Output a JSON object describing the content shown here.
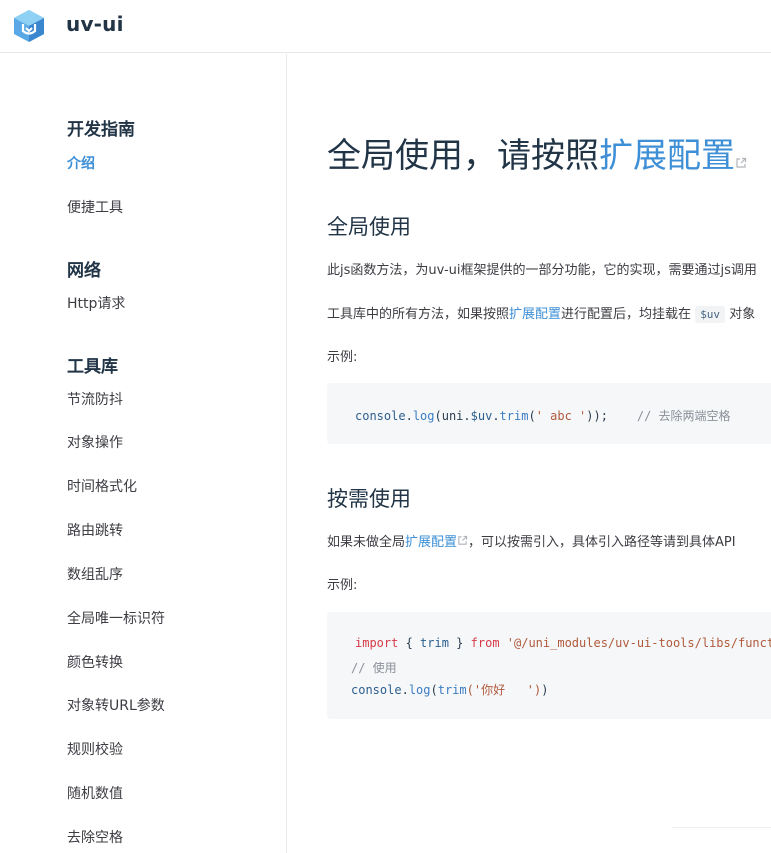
{
  "header": {
    "brand": "uv-ui",
    "logo_icon": "uv-ui-logo-icon"
  },
  "sidebar": {
    "groups": [
      {
        "title": "开发指南",
        "items": [
          "介绍",
          "便捷工具"
        ]
      },
      {
        "title": "网络",
        "items": [
          "Http请求"
        ]
      },
      {
        "title": "工具库",
        "items": [
          "节流防抖",
          "对象操作",
          "时间格式化",
          "路由跳转",
          "数组乱序",
          "全局唯一标识符",
          "颜色转换",
          "对象转URL参数",
          "规则校验",
          "随机数值",
          "去除空格"
        ]
      }
    ],
    "active_item": "介绍"
  },
  "main": {
    "title_prefix": "全局使用，请按照",
    "title_link": "扩展配置",
    "section1": {
      "heading": "全局使用",
      "para1": "此js函数方法，为uv-ui框架提供的一部分功能，它的实现，需要通过js调用",
      "para2_prefix": "工具库中的所有方法，如果按照",
      "para2_link": "扩展配置",
      "para2_middle": "进行配置后，均挂载在",
      "para2_code": "$uv",
      "para2_suffix": "对象",
      "example_label": "示例:",
      "code": {
        "obj": "console",
        "dot1": ".",
        "method1": "log",
        "open1": "(uni.",
        "var1": "$uv",
        "dot2": ".",
        "method2": "trim",
        "open2": "(",
        "arg": "' abc '",
        "close": "));",
        "comment": "// 去除两端空格"
      }
    },
    "section2": {
      "heading": "按需使用",
      "para_prefix": "如果未做全局",
      "para_link": "扩展配置",
      "para_suffix": "，可以按需引入，具体引入路径等请到具体API",
      "example_label": "示例:",
      "code": {
        "kw_import": "import",
        "brace_open": " { ",
        "name": "trim",
        "brace_close": " } ",
        "kw_from": "from",
        "path": "'@/uni_modules/uv-ui-tools/libs/function'",
        "comment": "// 使用",
        "obj": "console",
        "dot": ".",
        "method": "log",
        "open": "(",
        "fn": "trim",
        "arg": "('你好   ')",
        "close": ")"
      }
    }
  },
  "colors": {
    "accent": "#3e8fd6",
    "text": "#213547",
    "code_bg": "#f6f7f9",
    "divider": "#e6e8eb"
  }
}
